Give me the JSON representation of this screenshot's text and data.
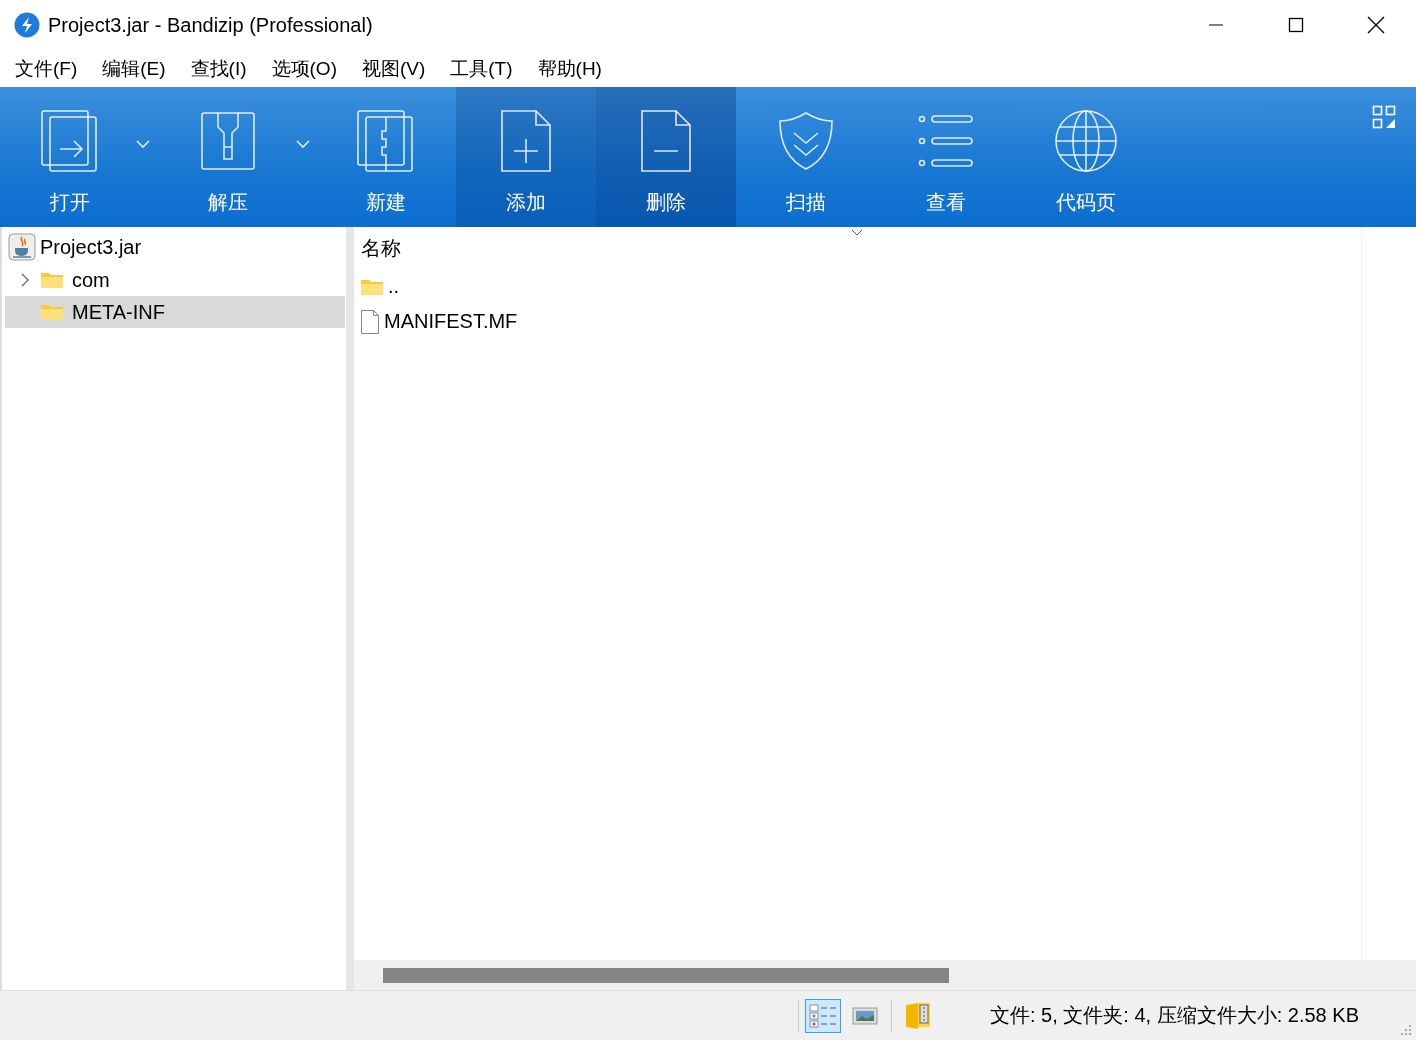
{
  "window": {
    "title": "Project3.jar - Bandizip (Professional)"
  },
  "menu": [
    "文件(F)",
    "编辑(E)",
    "查找(I)",
    "选项(O)",
    "视图(V)",
    "工具(T)",
    "帮助(H)"
  ],
  "toolbar": [
    {
      "kind": "open",
      "label": "打开",
      "dropdown": true,
      "highlighted": false
    },
    {
      "kind": "extract",
      "label": "解压",
      "dropdown": true,
      "highlighted": false
    },
    {
      "kind": "new",
      "label": "新建",
      "dropdown": false,
      "highlighted": false
    },
    {
      "kind": "add",
      "label": "添加",
      "dropdown": false,
      "highlighted": true
    },
    {
      "kind": "delete",
      "label": "删除",
      "dropdown": false,
      "highlighted": true
    },
    {
      "kind": "scan",
      "label": "扫描",
      "dropdown": false,
      "highlighted": false
    },
    {
      "kind": "view",
      "label": "查看",
      "dropdown": false,
      "highlighted": false
    },
    {
      "kind": "codepage",
      "label": "代码页",
      "dropdown": false,
      "highlighted": false
    }
  ],
  "tree": {
    "label": "Project3.jar",
    "children": [
      {
        "label": "com",
        "expandable": true,
        "selected": false
      },
      {
        "label": "META-INF",
        "expandable": false,
        "selected": true
      }
    ]
  },
  "file_list": {
    "columns": [
      "名称"
    ],
    "rows": [
      {
        "kind": "folder",
        "name": ".."
      },
      {
        "kind": "file",
        "name": "MANIFEST.MF"
      }
    ]
  },
  "status_bar": {
    "view_buttons": [
      {
        "kind": "details",
        "selected": true
      },
      {
        "kind": "thumbnails",
        "selected": false
      }
    ],
    "text": "文件: 5, 文件夹: 4, 压缩文件大小: 2.58 KB"
  }
}
